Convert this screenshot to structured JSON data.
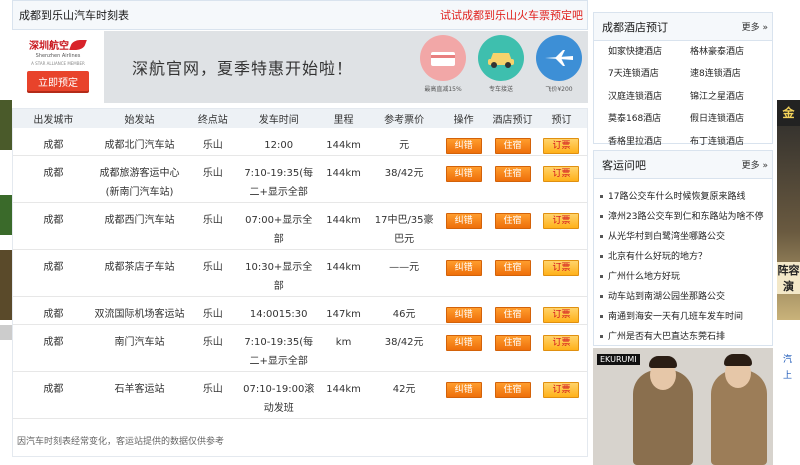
{
  "header": {
    "title": "成都到乐山汽车时刻表",
    "promo_link": "试试成都到乐山火车票预定吧"
  },
  "banner": {
    "logo_cn": "深圳航空",
    "logo_en": "Shenzhen Airlines",
    "logo_sub": "A STAR ALLIANCE MEMBER",
    "book_button": "立即预定",
    "slogan": "深航官网，夏季特惠开始啦！",
    "icons": [
      {
        "icon": "discount-icon",
        "caption": "最高直减15%"
      },
      {
        "icon": "car-icon",
        "caption": "专车接送"
      },
      {
        "icon": "plane-icon",
        "caption": "飞价¥200"
      }
    ]
  },
  "table": {
    "headers": [
      "出发城市",
      "始发站",
      "终点站",
      "发车时间",
      "里程",
      "参考票价",
      "操作",
      "酒店预订",
      "预订"
    ],
    "button_labels": {
      "op": "纠错",
      "hotel": "住宿",
      "book": "订票"
    },
    "rows": [
      {
        "from": "成都",
        "station": "成都北门汽车站",
        "to": "乐山",
        "time": "12:00",
        "km": "144km",
        "price": "元"
      },
      {
        "from": "成都",
        "station": "成都旅游客运中心(新南门汽车站)",
        "to": "乐山",
        "time": "7:10-19:35(每二+显示全部",
        "km": "144km",
        "price": "38/42元"
      },
      {
        "from": "成都",
        "station": "成都西门汽车站",
        "to": "乐山",
        "time": "07:00+显示全部",
        "km": "144km",
        "price": "17中巴/35豪巴元"
      },
      {
        "from": "成都",
        "station": "成都茶店子车站",
        "to": "乐山",
        "time": "10:30+显示全部",
        "km": "144km",
        "price": "——元"
      },
      {
        "from": "成都",
        "station": "双流国际机场客运站",
        "to": "乐山",
        "time": "14:0015:30",
        "km": "147km",
        "price": "46元"
      },
      {
        "from": "成都",
        "station": "南门汽车站",
        "to": "乐山",
        "time": "7:10-19:35(每二+显示全部",
        "km": "km",
        "price": "38/42元"
      },
      {
        "from": "成都",
        "station": "石羊客运站",
        "to": "乐山",
        "time": "07:10-19:00滚动发班",
        "km": "144km",
        "price": "42元"
      }
    ],
    "footnote": "因汽车时刻表经常变化，客运站提供的数据仅供参考"
  },
  "hotels": {
    "title": "成都酒店预订",
    "more": "更多",
    "items": [
      "如家快捷酒店",
      "格林豪泰酒店",
      "7天连锁酒店",
      "速8连锁酒店",
      "汉庭连锁酒店",
      "锦江之星酒店",
      "莫泰168酒店",
      "假日连锁酒店",
      "香格里拉酒店",
      "布丁连锁酒店"
    ]
  },
  "faq": {
    "title": "客运问吧",
    "more": "更多",
    "items": [
      "17路公交车什么时候恢复原来路线",
      "漳州23路公交车到仁和东路站为啥不停",
      "从光华村到白鹭湾坐哪路公交",
      "北京有什么好玩的地方？",
      "广州什么地方好玩",
      "动车站到南湖公园坐那路公交",
      "南通到海安一天有几班车发车时间",
      "广州是否有大巴直达东莞石排"
    ]
  },
  "side_ad": {
    "brand": "EKURUMI"
  },
  "far_right": {
    "top_text": "金",
    "mid_text": "阵容演",
    "links": [
      "汽",
      "上"
    ]
  }
}
